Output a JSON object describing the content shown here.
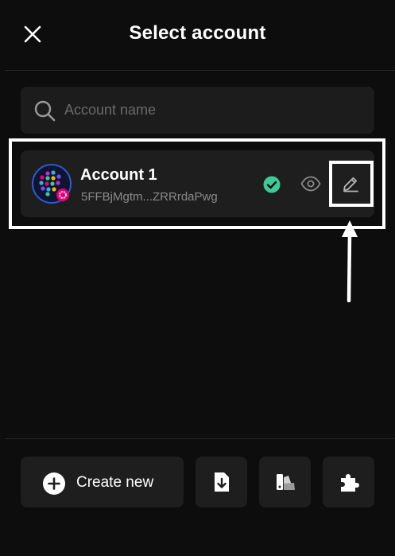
{
  "header": {
    "title": "Select account",
    "close_icon": "close-icon"
  },
  "search": {
    "placeholder": "Account name",
    "value": "",
    "icon": "search-icon"
  },
  "accounts": [
    {
      "name": "Account 1",
      "address": "5FFBjMgtm...ZRRrdaPwg",
      "selected": true,
      "icons": [
        "avatar",
        "check-icon",
        "eye-icon",
        "edit-icon"
      ]
    }
  ],
  "footer": {
    "create_label": "Create new",
    "buttons": [
      "import-icon",
      "theme-icon",
      "extension-icon"
    ]
  },
  "colors": {
    "background": "#0d0d0d",
    "card": "#1e1e1e",
    "accent_green": "#3ec998",
    "badge_pink": "#e6007a",
    "annotation": "#ffffff"
  }
}
